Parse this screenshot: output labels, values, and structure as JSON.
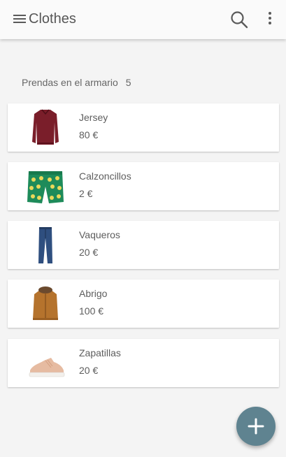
{
  "appbar": {
    "title": "Clothes",
    "icons": [
      "menu-icon",
      "search-icon",
      "more-vert-icon"
    ]
  },
  "list": {
    "header_label": "Prendas en el armario",
    "count": "5",
    "items": [
      {
        "name": "Jersey",
        "price": "80 €",
        "image": "sweater"
      },
      {
        "name": "Calzoncillos",
        "price": "2 €",
        "image": "boxer-shorts"
      },
      {
        "name": "Vaqueros",
        "price": "20 €",
        "image": "jeans"
      },
      {
        "name": "Abrigo",
        "price": "100 €",
        "image": "coat"
      },
      {
        "name": "Zapatillas",
        "price": "20 €",
        "image": "sneakers"
      }
    ]
  },
  "fab": {
    "icon": "plus-icon",
    "color": "#5f8390"
  },
  "colors": {
    "appbar": "#fafafa",
    "background": "#f4f4f4"
  }
}
